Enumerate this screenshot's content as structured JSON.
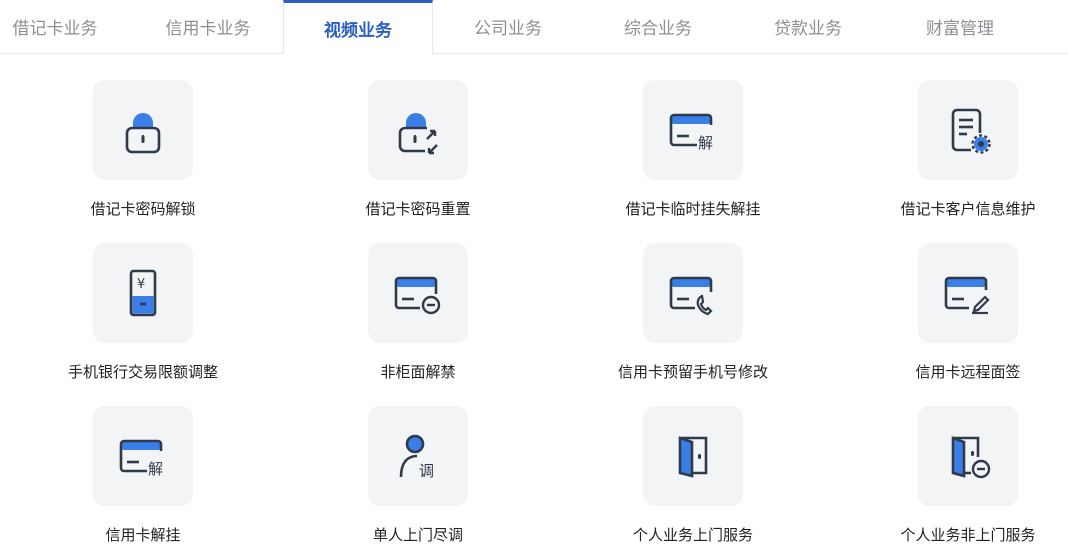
{
  "tabs": [
    {
      "label": "借记卡业务",
      "active": false
    },
    {
      "label": "信用卡业务",
      "active": false
    },
    {
      "label": "视频业务",
      "active": true
    },
    {
      "label": "公司业务",
      "active": false
    },
    {
      "label": "综合业务",
      "active": false
    },
    {
      "label": "贷款业务",
      "active": false
    },
    {
      "label": "财富管理",
      "active": false
    }
  ],
  "services": [
    {
      "label": "借记卡密码解锁",
      "icon": "padlock-icon"
    },
    {
      "label": "借记卡密码重置",
      "icon": "padlock-reset-icon"
    },
    {
      "label": "借记卡临时挂失解挂",
      "icon": "card-unfreeze-icon"
    },
    {
      "label": "借记卡客户信息维护",
      "icon": "document-settings-icon"
    },
    {
      "label": "手机银行交易限额调整",
      "icon": "phone-yuan-icon"
    },
    {
      "label": "非柜面解禁",
      "icon": "card-minus-icon"
    },
    {
      "label": "信用卡预留手机号修改",
      "icon": "card-phone-icon"
    },
    {
      "label": "信用卡远程面签",
      "icon": "card-sign-icon"
    },
    {
      "label": "信用卡解挂",
      "icon": "card-unfreeze-icon"
    },
    {
      "label": "单人上门尽调",
      "icon": "person-survey-icon"
    },
    {
      "label": "个人业务上门服务",
      "icon": "door-icon"
    },
    {
      "label": "个人业务非上门服务",
      "icon": "door-minus-icon"
    }
  ],
  "icon_text": {
    "unfreeze": "解",
    "yuan": "¥",
    "survey": "调"
  },
  "colors": {
    "accent": "#2b5fc2",
    "icon_blue": "#3a7ee8",
    "icon_dark": "#2f3a4a",
    "tile_bg": "#f3f4f6"
  }
}
